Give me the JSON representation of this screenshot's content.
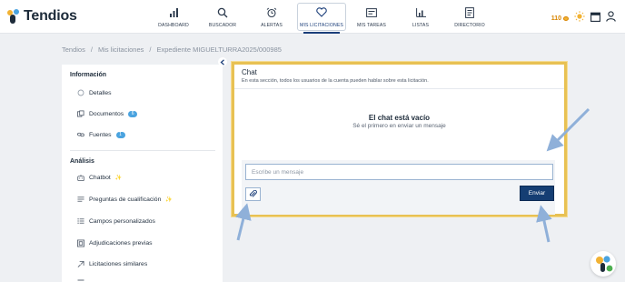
{
  "app": {
    "name": "Tendios"
  },
  "nav": {
    "items": [
      {
        "label": "DASHBOARD",
        "icon": "bar-chart-icon"
      },
      {
        "label": "BUSCADOR",
        "icon": "search-icon"
      },
      {
        "label": "ALERTAS",
        "icon": "alarm-clock-icon"
      },
      {
        "label": "MIS LICITACIONES",
        "icon": "heart-icon",
        "active": true
      },
      {
        "label": "MIS TAREAS",
        "icon": "task-board-icon"
      },
      {
        "label": "LISTAS",
        "icon": "list-chart-icon"
      },
      {
        "label": "DIRECTORIO",
        "icon": "directory-icon"
      }
    ]
  },
  "topright": {
    "credits": "110",
    "icons": [
      "coin-icon",
      "sun-icon",
      "calendar-icon",
      "user-icon"
    ]
  },
  "breadcrumb": {
    "items": [
      "Tendios",
      "Mis licitaciones",
      "Expediente MIGUELTURRA2025/000985"
    ],
    "separator": "/"
  },
  "sidebar": {
    "info_title": "Información",
    "info_items": [
      {
        "label": "Detalles",
        "icon": "circle-icon"
      },
      {
        "label": "Documentos",
        "icon": "documents-icon",
        "badge": "6"
      },
      {
        "label": "Fuentes",
        "icon": "link-icon",
        "badge": "1"
      }
    ],
    "analysis_title": "Análisis",
    "analysis_items": [
      {
        "label": "Chatbot",
        "icon": "chatbot-icon",
        "spark": "✨"
      },
      {
        "label": "Preguntas de cualificación",
        "icon": "questions-icon",
        "spark": "✨"
      },
      {
        "label": "Campos personalizados",
        "icon": "fields-icon"
      },
      {
        "label": "Adjudicaciones previas",
        "icon": "awards-icon"
      },
      {
        "label": "Licitaciones similares",
        "icon": "similar-icon"
      }
    ]
  },
  "chat": {
    "title": "Chat",
    "subtitle": "En esta sección, todos los usuarios de la cuenta pueden hablar sobre esta licitación.",
    "empty_title": "El chat está vacío",
    "empty_subtitle": "Sé el primero en enviar un mensaje",
    "input_placeholder": "Escribe un mensaje",
    "send_label": "Enviar"
  },
  "colors": {
    "accent": "#153e73",
    "highlight": "#e8c153",
    "badge": "#4aa3df",
    "arrow": "#8fb0d9"
  }
}
